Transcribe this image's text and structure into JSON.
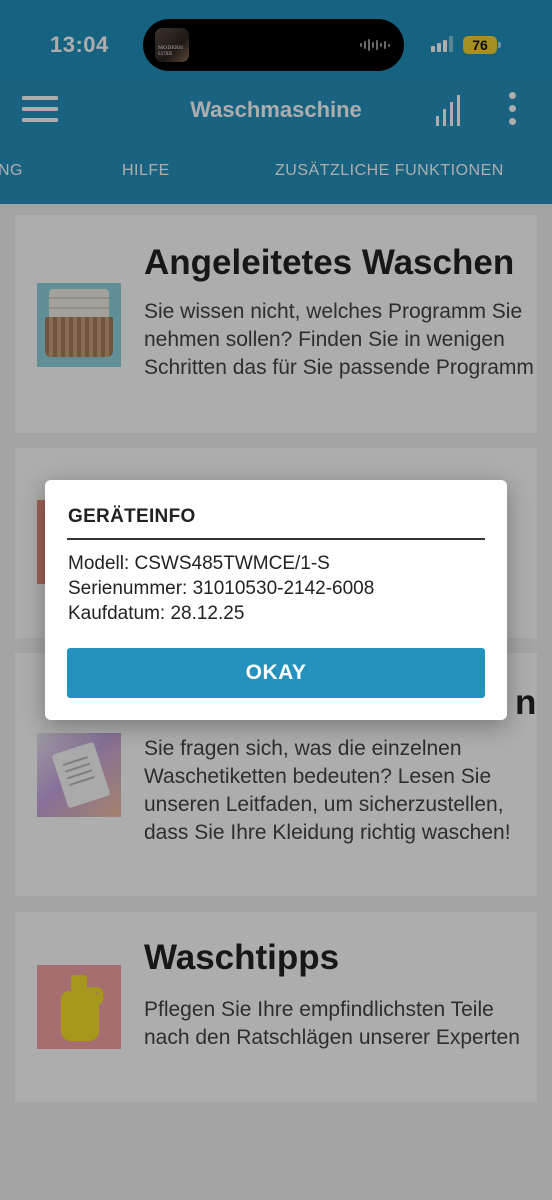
{
  "status_bar": {
    "time": "13:04",
    "island_thumb_text": "MODERN LUXE",
    "battery": "76"
  },
  "appbar": {
    "title": "Waschmaschine",
    "menu_icon": "hamburger-menu-icon",
    "stats_icon": "bar-chart-icon",
    "more_icon": "more-vertical-icon"
  },
  "tabs": [
    {
      "label": "NG"
    },
    {
      "label": "HILFE"
    },
    {
      "label": "ZUSÄTZLICHE FUNKTIONEN"
    }
  ],
  "cards": [
    {
      "title": "Angeleitetes Waschen",
      "text": "Sie wissen nicht, welches Programm Sie nehmen sollen? Finden Sie in wenigen Schritten das für Sie passende Programm",
      "image": "laundry-basket-image"
    },
    {
      "title": "",
      "text": "",
      "image": "pink-image"
    },
    {
      "title": "n",
      "text": "Sie fragen sich, was die einzelnen Waschetiketten bedeuten? Lesen Sie unseren Leitfaden, um sicherzustellen, dass Sie Ihre Kleidung richtig waschen!",
      "image": "wash-label-image"
    },
    {
      "title": "Waschtipps",
      "text": "Pflegen Sie Ihre empfindlichsten Teile nach den Ratschlägen unserer Experten",
      "image": "detergent-bottle-image"
    }
  ],
  "dialog": {
    "title": "GERÄTEINFO",
    "model": "Modell: CSWS485TWMCE/1-S",
    "serial": "Serienummer: 31010530-2142-6008",
    "purchase_date": "Kaufdatum: 28.12.25",
    "ok_label": "OKAY"
  },
  "colors": {
    "primary": "#2591bd",
    "battery": "#f5d531",
    "background": "#f2f2f2"
  }
}
